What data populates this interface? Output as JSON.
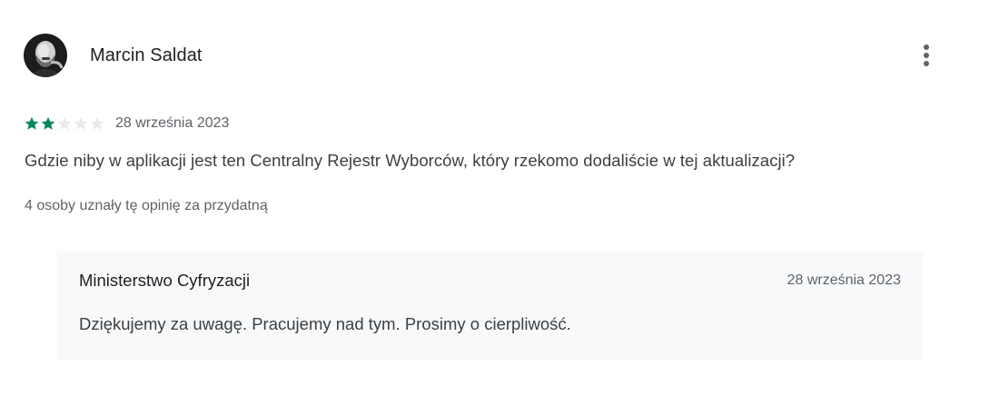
{
  "review": {
    "author": "Marcin Saldat",
    "avatar_icon": "user-avatar",
    "menu_icon": "more-vert-icon",
    "rating": 2,
    "max_rating": 5,
    "date": "28 września 2023",
    "text": "Gdzie niby w aplikacji jest ten Centralny Rejestr Wyborców, który rzekomo dodaliście w tej aktualizacji?",
    "helpful": "4 osoby uznały tę opinię za przydatną"
  },
  "reply": {
    "developer": "Ministerstwo Cyfryzacji",
    "date": "28 września 2023",
    "text": "Dziękujemy za uwagę. Pracujemy nad tym. Prosimy o cierpliwość."
  },
  "colors": {
    "star_filled": "#01875f",
    "star_empty": "#e8eaed",
    "reply_bg": "#f8f9fa"
  }
}
